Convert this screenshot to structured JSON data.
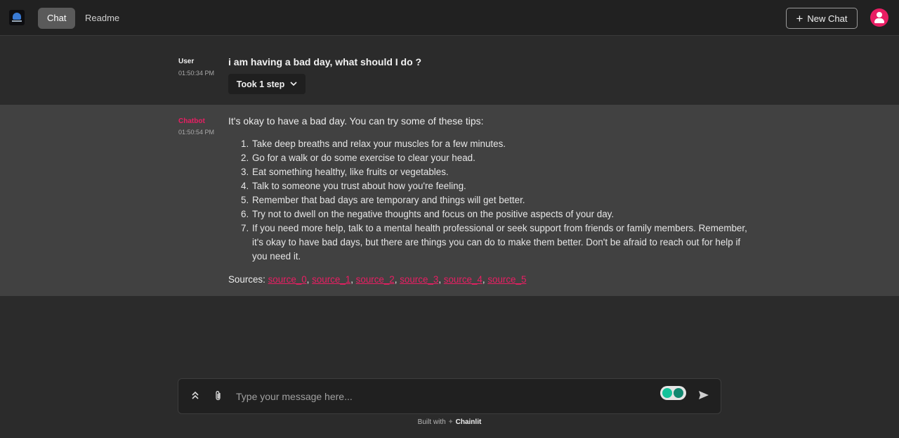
{
  "header": {
    "tabs": [
      {
        "label": "Chat",
        "active": true
      },
      {
        "label": "Readme",
        "active": false
      }
    ],
    "new_chat_label": "New Chat",
    "accent_color": "#e91e63"
  },
  "messages": {
    "user": {
      "author": "User",
      "time": "01:50:34 PM",
      "text": "i am having a bad day, what should I do ?",
      "steps_label": "Took 1 step"
    },
    "bot": {
      "author": "Chatbot",
      "time": "01:50:54 PM",
      "intro": "It's okay to have a bad day. You can try some of these tips:",
      "tips": [
        "Take deep breaths and relax your muscles for a few minutes.",
        "Go for a walk or do some exercise to clear your head.",
        "Eat something healthy, like fruits or vegetables.",
        "Talk to someone you trust about how you're feeling.",
        "Remember that bad days are temporary and things will get better.",
        "Try not to dwell on the negative thoughts and focus on the positive aspects of your day.",
        "If you need more help, talk to a mental health professional or seek support from friends or family members. Remember, it's okay to have bad days, but there are things you can do to make them better. Don't be afraid to reach out for help if you need it."
      ],
      "sources_label": "Sources:",
      "sources": [
        "source_0",
        "source_1",
        "source_2",
        "source_3",
        "source_4",
        "source_5"
      ]
    }
  },
  "composer": {
    "placeholder": "Type your message here..."
  },
  "footer": {
    "built_with": "Built with",
    "brand": "Chainlit"
  }
}
